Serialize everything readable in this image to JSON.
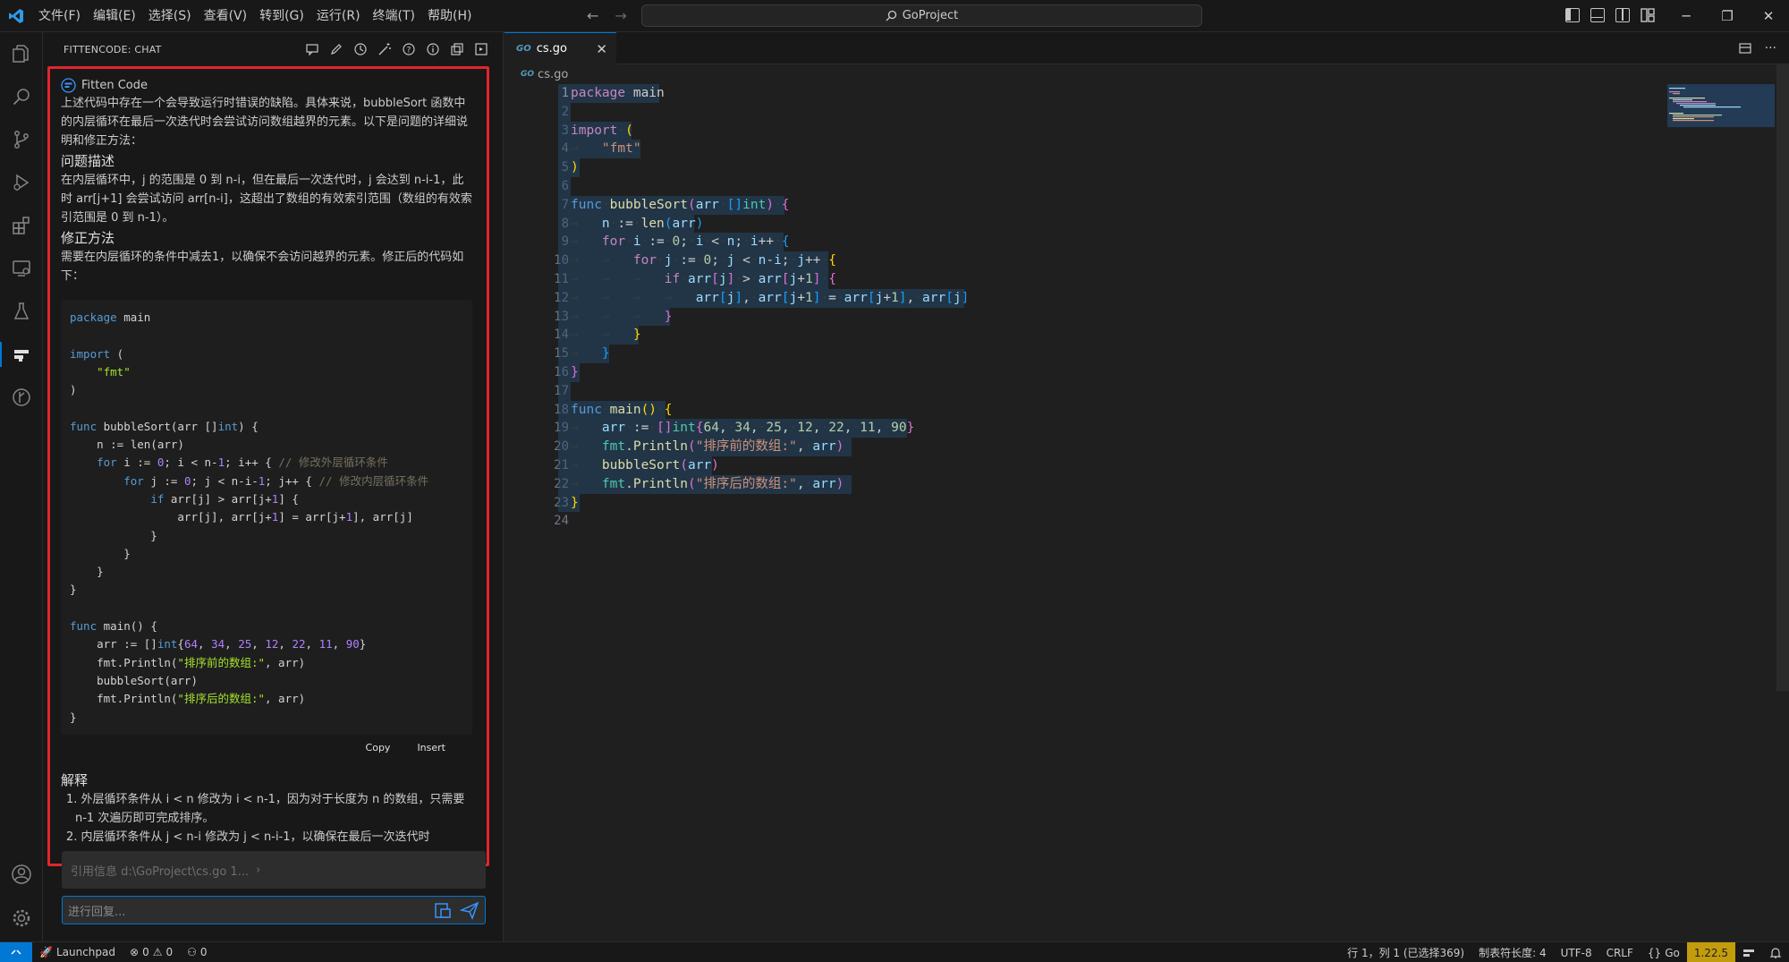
{
  "titlebar": {
    "menu": [
      "文件(F)",
      "编辑(E)",
      "选择(S)",
      "查看(V)",
      "转到(G)",
      "运行(R)",
      "终端(T)",
      "帮助(H)"
    ],
    "search": "GoProject"
  },
  "chat": {
    "panel_title": "FITTENCODE: CHAT",
    "sender": "Fitten Code",
    "intro": "上述代码中存在一个会导致运行时错误的缺陷。具体来说，bubbleSort 函数中的内层循环在最后一次迭代时会尝试访问数组越界的元素。以下是问题的详细说明和修正方法：",
    "heading_problem": "问题描述",
    "problem_text": "在内层循环中，j 的范围是 0 到 n-i，但在最后一次迭代时，j 会达到 n-i-1，此时 arr[j+1] 会尝试访问 arr[n-i]，这超出了数组的有效索引范围（数组的有效索引范围是 0 到 n-1）。",
    "heading_fix": "修正方法",
    "fix_text": "需要在内层循环的条件中减去1，以确保不会访问越界的元素。修正后的代码如下：",
    "copy_label": "Copy",
    "insert_label": "Insert",
    "heading_explain": "解释",
    "explain_1": "1. 外层循环条件从 i < n 修改为 i < n-1，因为对于长度为 n 的数组，只需要 n-1 次遍历即可完成排序。",
    "explain_2": "2. 内层循环条件从 j < n-i 修改为 j < n-i-1，以确保在最后一次迭代时",
    "ref_info": "引用信息 d:\\GoProject\\cs.go 1...",
    "reply_placeholder": "进行回复..."
  },
  "editor": {
    "tab_label": "cs.go",
    "breadcrumb_file": "cs.go",
    "minimap_color": "#264f78"
  },
  "statusbar": {
    "launchpad": "Launchpad",
    "errors": "0",
    "warnings": "0",
    "ports": "0",
    "position": "行 1，列 1 (已选择369)",
    "tab_size": "制表符长度: 4",
    "encoding": "UTF-8",
    "eol": "CRLF",
    "language": "Go",
    "go_version": "1.22.5"
  },
  "colors": {
    "accent": "#0078d4",
    "highlight_border": "#e0262b",
    "go_badge": "#c29c0c"
  }
}
